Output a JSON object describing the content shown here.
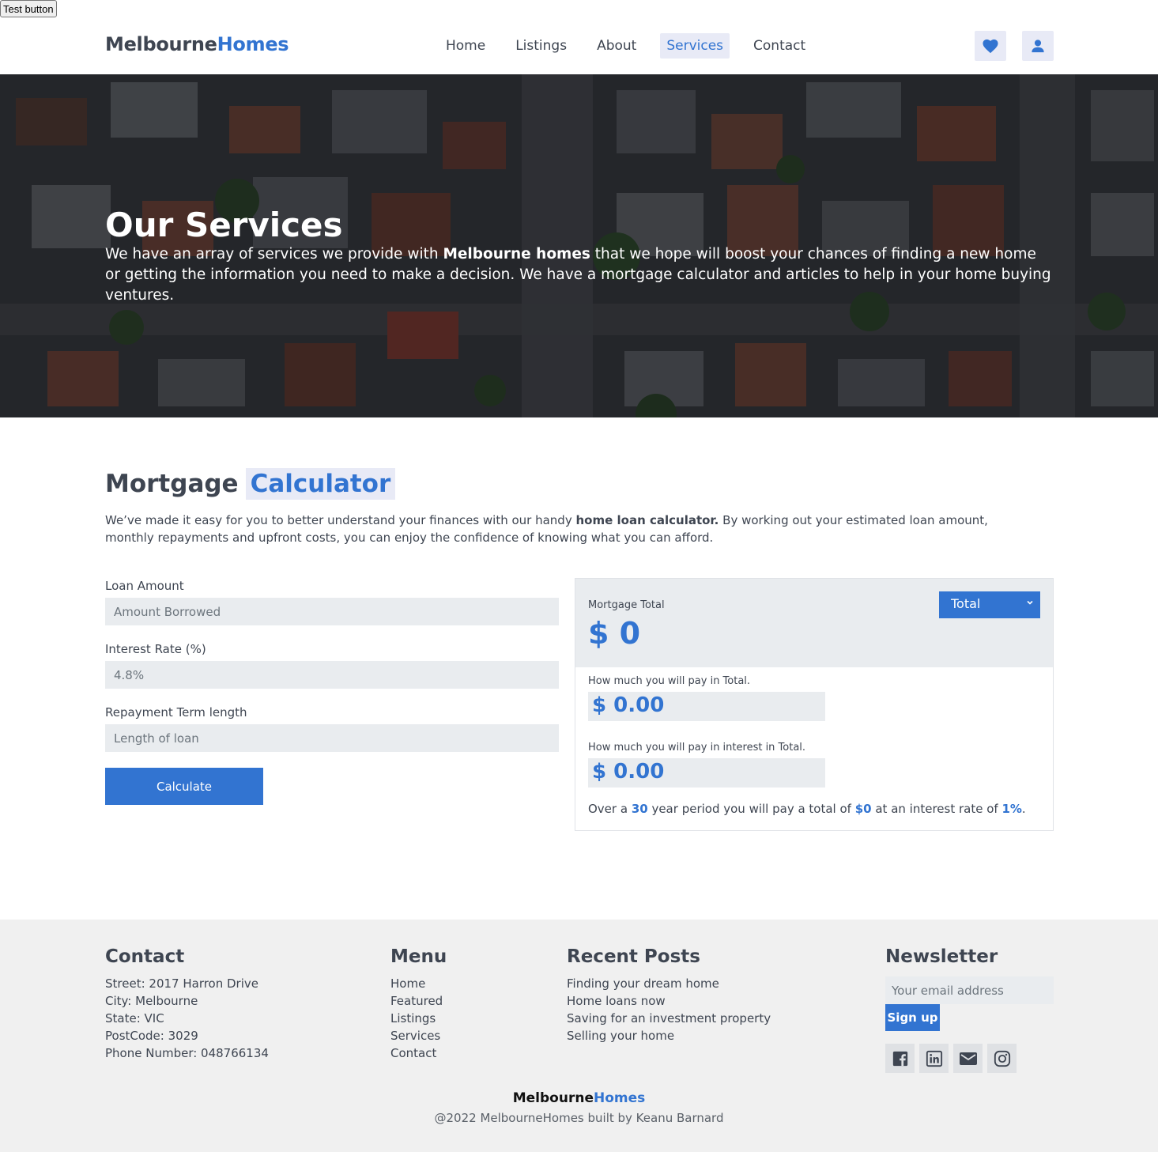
{
  "test_button": "Test button",
  "nav": {
    "brand_main": "Melbourne",
    "brand_accent": "Homes",
    "links": [
      "Home",
      "Listings",
      "About",
      "Services",
      "Contact"
    ],
    "active_link": "Services"
  },
  "hero": {
    "title": "Our Services",
    "text_before": "We have an array of services we provide with ",
    "text_bold": "Melbourne homes",
    "text_after": " that we hope will boost your chances of finding a new home or getting the information you need to make a decision. We have a mortgage calculator and articles to help in your home buying ventures."
  },
  "mortgage": {
    "title_main": "Mortgage",
    "title_accent": "Calculator",
    "desc_before": "We’ve made it easy for you to better understand your finances with our handy ",
    "desc_bold": "home loan calculator.",
    "desc_after": " By working out your estimated loan amount, monthly repayments and upfront costs, you can enjoy the confidence of knowing what you can afford.",
    "loan_label": "Loan Amount",
    "loan_placeholder": "Amount Borrowed",
    "rate_label": "Interest Rate (%)",
    "rate_placeholder": "4.8%",
    "term_label": "Repayment Term length",
    "term_placeholder": "Length of loan",
    "calculate_label": "Calculate"
  },
  "results": {
    "head_label": "Mortgage Total",
    "head_value": "$ 0",
    "select_value": "Total",
    "total_label": "How much you will pay in Total.",
    "total_value": "$ 0.00",
    "interest_label": "How much you will pay in interest in Total.",
    "interest_value": "$ 0.00",
    "summary_1": "Over a ",
    "summary_years": "30",
    "summary_2": " year period you will pay a total of ",
    "summary_total": "$0",
    "summary_3": " at an interest rate of ",
    "summary_rate": "1%",
    "summary_4": "."
  },
  "footer": {
    "contact_title": "Contact",
    "contact_items": [
      "Street: 2017 Harron Drive",
      "City: Melbourne",
      "State: VIC",
      "PostCode: 3029",
      "Phone Number: 048766134"
    ],
    "menu_title": "Menu",
    "menu_items": [
      "Home",
      "Featured",
      "Listings",
      "Services",
      "Contact"
    ],
    "posts_title": "Recent Posts",
    "posts_items": [
      "Finding your dream home",
      "Home loans now",
      "Saving for an investment property",
      "Selling your home"
    ],
    "newsletter_title": "Newsletter",
    "email_placeholder": "Your email address",
    "signup_label": "Sign up",
    "brand_main": "Melbourne",
    "brand_accent": "Homes",
    "copyright": "@2022 MelbourneHomes built by Keanu Barnard"
  },
  "icons": {
    "favorites": "heart-icon",
    "account": "user-icon",
    "socials": [
      "facebook-icon",
      "linkedin-icon",
      "email-icon",
      "instagram-icon"
    ]
  },
  "colors": {
    "accent": "#3274d1",
    "accent_bg": "#e8eaf6",
    "text": "#3e4551",
    "footer_bg": "#f0f0f0"
  }
}
